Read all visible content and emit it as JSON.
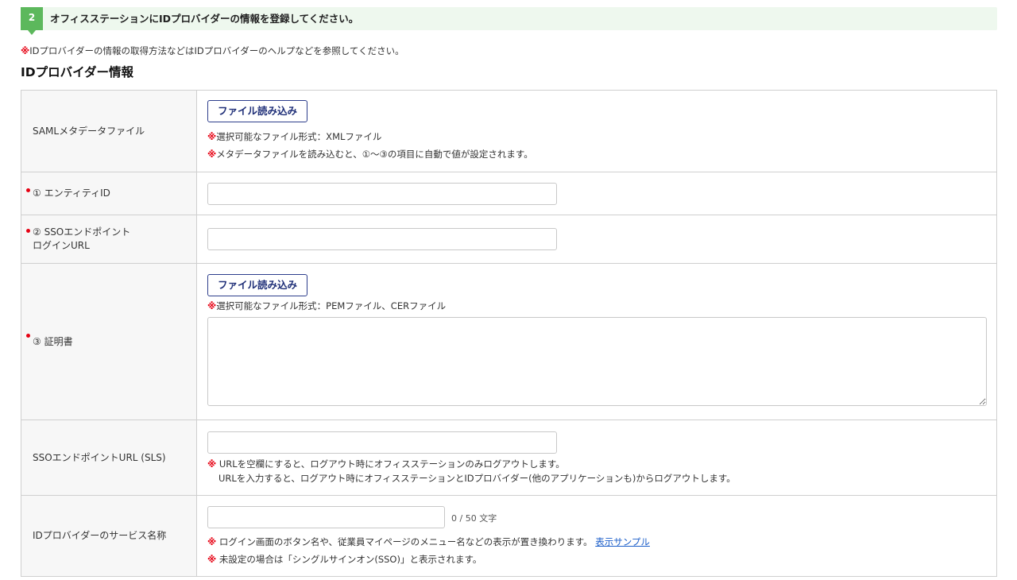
{
  "step": {
    "number": "2",
    "text": "オフィスステーションにIDプロバイダーの情報を登録してください。"
  },
  "note_mark": "※",
  "top_note": "IDプロバイダーの情報の取得方法などはIDプロバイダーのヘルプなどを参照してください。",
  "section_title": "IDプロバイダー情報",
  "rows": {
    "saml": {
      "label": "SAMLメタデータファイル",
      "button": "ファイル読み込み",
      "note1": "選択可能なファイル形式：XMLファイル",
      "note2": "メタデータファイルを読み込むと、①〜③の項目に自動で値が設定されます。"
    },
    "entity_id": {
      "label": "① エンティティID",
      "value": ""
    },
    "sso_login": {
      "label_line1": "② SSOエンドポイント",
      "label_line2": "ログインURL",
      "value": ""
    },
    "certificate": {
      "label": "③ 証明書",
      "button": "ファイル読み込み",
      "note": "選択可能なファイル形式：PEMファイル、CERファイル",
      "value": ""
    },
    "sls": {
      "label": "SSOエンドポイントURL (SLS)",
      "value": "",
      "note1": " URLを空欄にすると、ログアウト時にオフィスステーションのみログアウトします。",
      "note2": "URLを入力すると、ログアウト時にオフィスステーションとIDプロバイダー(他のアプリケーションも)からログアウトします。"
    },
    "service_name": {
      "label": "IDプロバイダーのサービス名称",
      "value": "",
      "counter": "0 / 50 文字",
      "note1": " ログイン画面のボタン名や、従業員マイページのメニュー名などの表示が置き換わります。",
      "link": "表示サンプル",
      "note2": " 未設定の場合は「シングルサインオン(SSO)」と表示されます。"
    }
  }
}
